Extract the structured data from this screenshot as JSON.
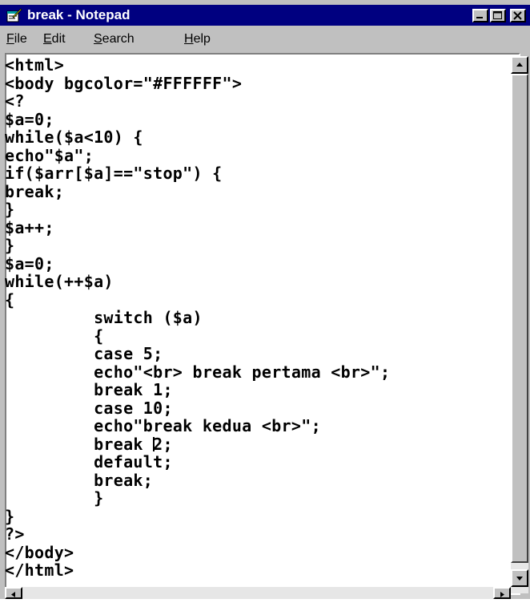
{
  "window": {
    "title": "break - Notepad"
  },
  "menu": {
    "items": [
      {
        "key": "F",
        "rest": "ile"
      },
      {
        "key": "E",
        "rest": "dit"
      },
      {
        "key": "S",
        "rest": "earch"
      },
      {
        "key": "H",
        "rest": "elp"
      }
    ]
  },
  "editor": {
    "lines": [
      "<html>",
      "<body bgcolor=\"#FFFFFF\">",
      "<?",
      "$a=0;",
      "while($a<10) {",
      "echo\"$a\";",
      "if($arr[$a]==\"stop\") {",
      "break;",
      "}",
      "$a++;",
      "}",
      "$a=0;",
      "while(++$a)",
      "{",
      "         switch ($a)",
      "         {",
      "         case 5;",
      "         echo\"<br> break pertama <br>\";",
      "         break 1;",
      "         case 10;",
      "         echo\"break kedua <br>\";",
      "         break 2;",
      "         default;",
      "         break;",
      "         }",
      "}",
      "?>",
      "</body>",
      "</html>"
    ],
    "caret": {
      "line_index": 21,
      "column": 15
    }
  },
  "colors": {
    "titlebar": "#000080",
    "window_face": "#c0c0c0",
    "editor_bg": "#ffffff"
  },
  "icons": {
    "app": "notepad-icon",
    "minimize": "minimize-icon",
    "maximize": "maximize-icon",
    "close": "close-icon",
    "scroll_up": "arrow-up-icon",
    "scroll_down": "arrow-down-icon",
    "scroll_left": "arrow-left-icon",
    "scroll_right": "arrow-right-icon"
  }
}
